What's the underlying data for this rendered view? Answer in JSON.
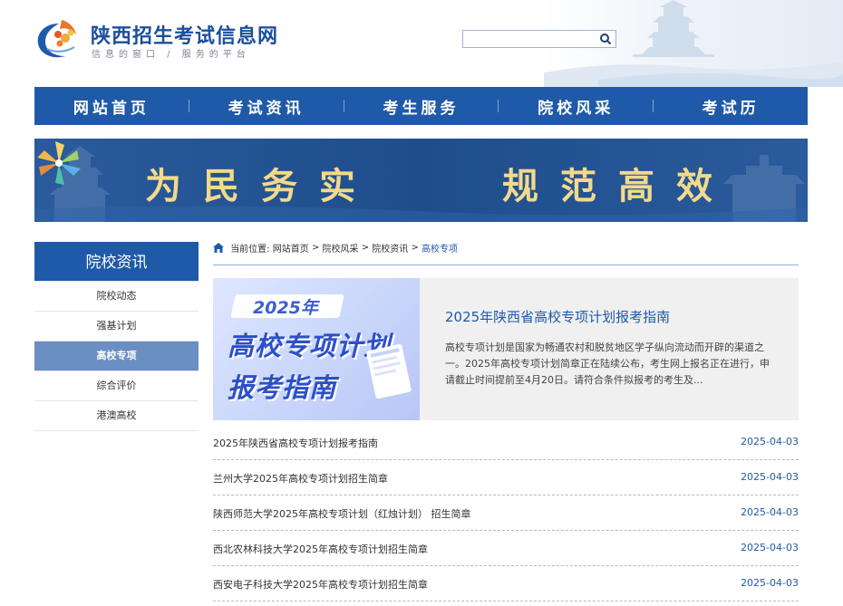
{
  "header": {
    "title": "陕西招生考试信息网",
    "subtitle": "信息的窗口 / 服务的平台",
    "search_placeholder": ""
  },
  "nav": {
    "items": [
      {
        "label": "网站首页"
      },
      {
        "label": "考试资讯"
      },
      {
        "label": "考生服务"
      },
      {
        "label": "院校风采"
      },
      {
        "label": "考试历"
      }
    ]
  },
  "banner": {
    "left_text": "为民务实",
    "right_text": "规范高效"
  },
  "sidebar": {
    "heading": "院校资讯",
    "items": [
      {
        "label": "院校动态"
      },
      {
        "label": "强基计划"
      },
      {
        "label": "高校专项"
      },
      {
        "label": "综合评价"
      },
      {
        "label": "港澳高校"
      }
    ],
    "active_index": 2
  },
  "breadcrumb": {
    "prefix": "当前位置:",
    "items": [
      "网站首页",
      "院校风采",
      "院校资讯",
      "高校专项"
    ],
    "separator": ">"
  },
  "featured": {
    "image": {
      "year": "2025年",
      "line1": "高校专项计划",
      "line2": "报考指南"
    },
    "title": "2025年陕西省高校专项计划报考指南",
    "summary": "高校专项计划是国家为畅通农村和脱贫地区学子纵向流动而开辟的渠道之一。2025年高校专项计划简章正在陆续公布，考生网上报名正在进行，申请截止时间提前至4月20日。请符合条件拟报考的考生及..."
  },
  "news": [
    {
      "title": "2025年陕西省高校专项计划报考指南",
      "date": "2025-04-03"
    },
    {
      "title": "兰州大学2025年高校专项计划招生简章",
      "date": "2025-04-03"
    },
    {
      "title": "陕西师范大学2025年高校专项计划（红烛计划） 招生简章",
      "date": "2025-04-03"
    },
    {
      "title": "西北农林科技大学2025年高校专项计划招生简章",
      "date": "2025-04-03"
    },
    {
      "title": "西安电子科技大学2025年高校专项计划招生简章",
      "date": "2025-04-03"
    }
  ],
  "colors": {
    "primary": "#1f5aa8",
    "active_sidebar": "#6b8fc2",
    "banner_bg": "#21508f",
    "banner_text": "#f3d98a"
  }
}
